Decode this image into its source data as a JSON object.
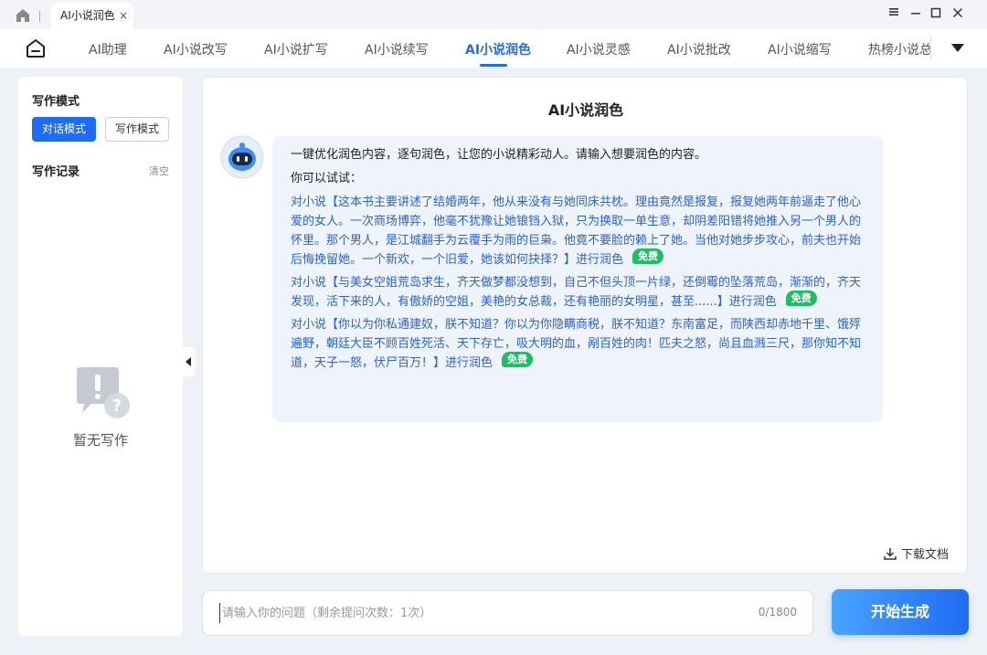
{
  "titlebar": {
    "tab_label": "AI小说润色",
    "tab_close": "×"
  },
  "nav": {
    "items": [
      {
        "label": "AI助理"
      },
      {
        "label": "AI小说改写"
      },
      {
        "label": "AI小说扩写"
      },
      {
        "label": "AI小说续写"
      },
      {
        "label": "AI小说润色"
      },
      {
        "label": "AI小说灵感"
      },
      {
        "label": "AI小说批改"
      },
      {
        "label": "AI小说缩写"
      },
      {
        "label": "热榜小说总"
      }
    ],
    "active": "AI小说润色"
  },
  "sidebar": {
    "mode_title": "写作模式",
    "mode_chat": "对话模式",
    "mode_write": "写作模式",
    "record_title": "写作记录",
    "clear_label": "清空",
    "empty_text": "暂无写作"
  },
  "main": {
    "title": "AI小说润色",
    "intro": "一键优化润色内容，逐句润色，让您的小说精彩动人。请输入想要润色的内容。",
    "try_label": "你可以试试：",
    "free_label": "免费",
    "examples": [
      "对小说【这本书主要讲述了结婚两年，他从来没有与她同床共枕。理由竟然是报复，报复她两年前逼走了他心爱的女人。一次商场博弈，他毫不犹豫让她锒铛入狱，只为换取一单生意，却阴差阳错将她推入另一个男人的怀里。那个男人，是江城翻手为云覆手为雨的巨枭。他竟不要脸的赖上了她。当他对她步步攻心，前夫也开始后悔挽留她。一个新欢，一个旧爱，她该如何抉择？】进行润色",
      "对小说【与美女空姐荒岛求生，齐天做梦都没想到，自己不但头顶一片绿，还倒霉的坠落荒岛，渐渐的，齐天发现，活下来的人，有傲娇的空姐，美艳的女总裁，还有艳丽的女明星，甚至......】进行润色",
      "对小说【你以为你私通建奴，朕不知道？你以为你隐瞒商税，朕不知道？东南富足，而陕西却赤地千里、饿殍遍野，朝廷大臣不顾百姓死活、天下存亡，吸大明的血，剐百姓的肉！匹夫之怒，尚且血溅三尺，那你知不知道，天子一怒，伏尸百万！】进行润色"
    ],
    "download_label": "下载文档"
  },
  "input": {
    "placeholder": "请输入你的问题（剩余提问次数：1次）",
    "value": "",
    "count": "0/1800"
  },
  "generate_label": "开始生成",
  "colors": {
    "accent": "#1e6cf2",
    "free_badge": "#1dbf63",
    "example_text": "#2a62d8",
    "bubble_bg": "#eef3fc"
  },
  "icons": [
    "home-icon",
    "nav-home-icon",
    "minimize-icon",
    "maximize-icon",
    "close-icon",
    "more-icon",
    "pin-icon",
    "robot-avatar-icon",
    "empty-message-icon",
    "download-icon",
    "collapse-icon"
  ]
}
